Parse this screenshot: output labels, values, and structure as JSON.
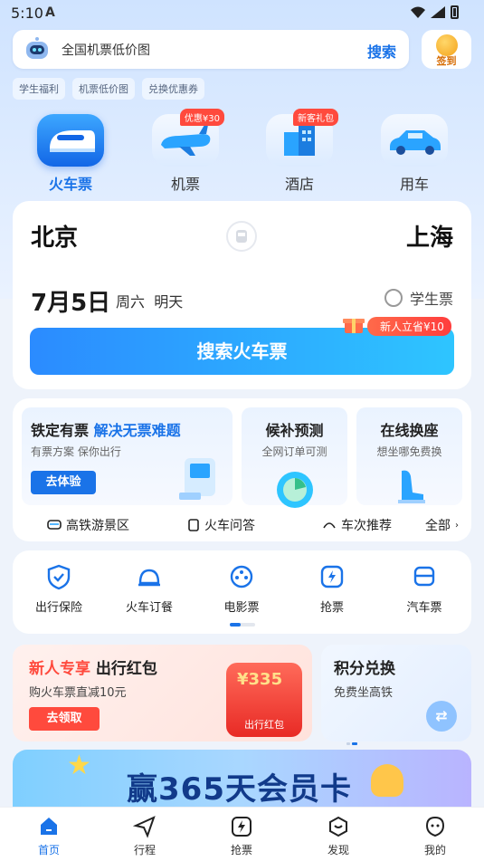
{
  "status_bar": {
    "time": "5:10"
  },
  "search": {
    "placeholder": "全国机票低价图",
    "button": "搜索"
  },
  "checkin": {
    "label": "签到"
  },
  "quick_tags": [
    "学生福利",
    "机票低价图",
    "兑换优惠券"
  ],
  "categories": [
    {
      "label": "火车票",
      "badge": ""
    },
    {
      "label": "机票",
      "badge": "优惠¥30"
    },
    {
      "label": "酒店",
      "badge": "新客礼包"
    },
    {
      "label": "用车",
      "badge": ""
    }
  ],
  "booking": {
    "from": "北京",
    "to": "上海",
    "date": "7月5日",
    "weekday": "周六",
    "relative_day": "明天",
    "student_ticket": "学生票",
    "search_button": "搜索火车票",
    "promo": "新人立省¥10"
  },
  "services": {
    "tile1_title": "铁定有票",
    "tile1_title_highlight": "解决无票难题",
    "tile1_sub": "有票方案 保你出行",
    "tile1_button": "去体验",
    "tile2_title": "候补预测",
    "tile2_sub": "全网订单可测",
    "tile3_title": "在线换座",
    "tile3_sub": "想坐哪免费换",
    "links": [
      "高铁游景区",
      "火车问答",
      "车次推荐",
      "全部"
    ]
  },
  "quick_services": [
    "出行保险",
    "火车订餐",
    "电影票",
    "抢票",
    "汽车票"
  ],
  "red_packet": {
    "title_highlight": "新人专享",
    "title": "出行红包",
    "subtitle": "购火车票直减10元",
    "button": "去领取",
    "amount": "¥335",
    "packet_label": "出行红包"
  },
  "points": {
    "title": "积分兑换",
    "subtitle": "免费坐高铁",
    "icon": "⇄"
  },
  "vip_banner": {
    "text": "赢365天会员卡"
  },
  "bottom_nav": [
    "首页",
    "行程",
    "抢票",
    "发现",
    "我的"
  ],
  "colors": {
    "accent": "#1a73e8",
    "red": "#ff4a3d"
  }
}
